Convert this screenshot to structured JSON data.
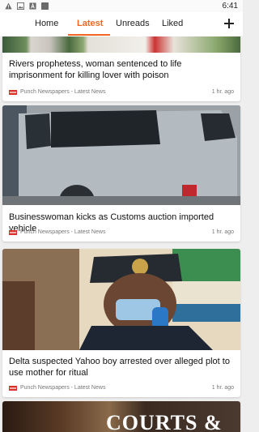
{
  "status_bar": {
    "time": "6:41",
    "icons": [
      "warning-icon",
      "image-icon",
      "text-a-icon",
      "square-icon"
    ]
  },
  "tabs": [
    {
      "label": "Home",
      "active": false
    },
    {
      "label": "Latest",
      "active": true
    },
    {
      "label": "Unreads",
      "active": false
    },
    {
      "label": "Liked",
      "active": false
    }
  ],
  "colors": {
    "accent": "#f26522",
    "logo_red": "#d9342b"
  },
  "articles": [
    {
      "title": "Rivers prophetess, woman sentenced to life imprisonment for killing lover with poison",
      "source": "Punch Newspapers - Latest News",
      "time": "1 hr. ago"
    },
    {
      "title": "Businesswoman kicks as Customs auction imported vehicle",
      "source": "Punch Newspapers - Latest News",
      "time": "1 hr. ago"
    },
    {
      "title": "Delta suspected Yahoo boy arrested over alleged plot to use mother for ritual",
      "source": "Punch Newspapers - Latest News",
      "time": "1 hr. ago"
    },
    {
      "image_text": "COURTS &"
    }
  ]
}
